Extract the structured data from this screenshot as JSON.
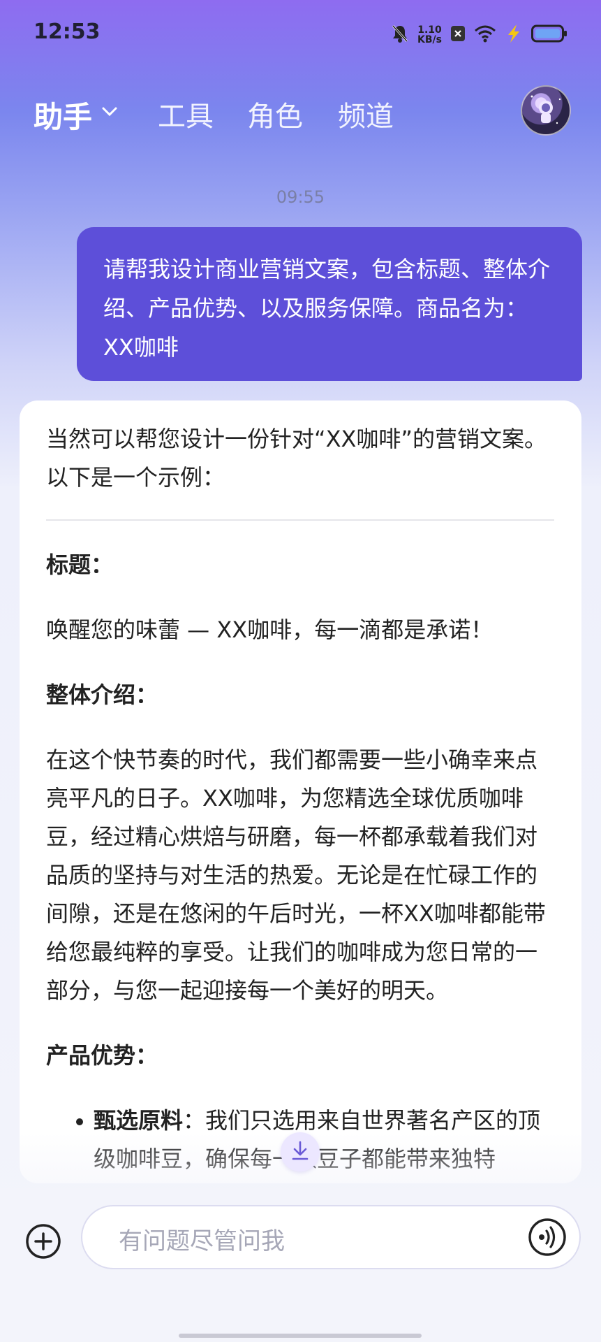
{
  "status_bar": {
    "time": "12:53",
    "net_speed_value": "1.10",
    "net_speed_unit": "KB/s",
    "icons": [
      "mute-bell-icon",
      "net-speed",
      "close-badge-icon",
      "wifi-icon",
      "charging-bolt-icon",
      "battery-icon"
    ]
  },
  "header": {
    "tabs": [
      {
        "label": "助手",
        "active": true
      },
      {
        "label": "工具"
      },
      {
        "label": "角色"
      },
      {
        "label": "频道"
      }
    ]
  },
  "chat": {
    "timestamp": "09:55",
    "user_message": "请帮我设计商业营销文案，包含标题、整体介绍、产品优势、以及服务保障。商品名为：XX咖啡",
    "assistant": {
      "intro": "当然可以帮您设计一份针对“XX咖啡”的营销文案。以下是一个示例：",
      "title_heading": "标题：",
      "title_text": "唤醒您的味蕾 — XX咖啡，每一滴都是承诺！",
      "overview_heading": "整体介绍：",
      "overview_text": "在这个快节奏的时代，我们都需要一些小确幸来点亮平凡的日子。XX咖啡，为您精选全球优质咖啡豆，经过精心烘焙与研磨，每一杯都承载着我们对品质的坚持与对生活的热爱。无论是在忙碌工作的间隙，还是在悠闲的午后时光，一杯XX咖啡都能带给您最纯粹的享受。让我们的咖啡成为您日常的一部分，与您一起迎接每一个美好的明天。",
      "advantages_heading": "产品优势：",
      "advantages": [
        {
          "label": "甄选原料",
          "text": "：我们只选用来自世界著名产区的顶级咖啡豆，确保每一颗豆子都能带来独特"
        }
      ]
    }
  },
  "input": {
    "placeholder": "有问题尽管问我"
  },
  "colors": {
    "accent": "#5d4fd9",
    "background_top": "#8e6cf0",
    "card": "#ffffff"
  }
}
